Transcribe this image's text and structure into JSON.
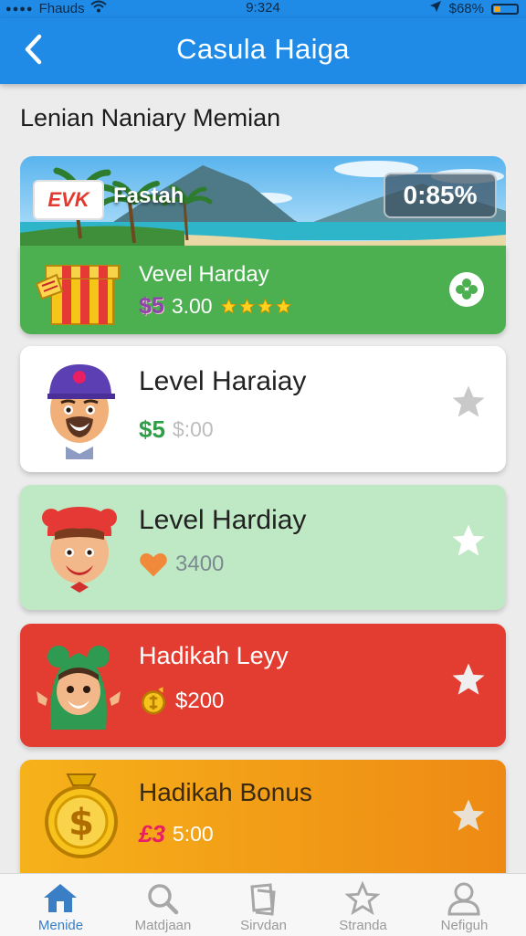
{
  "status_bar": {
    "carrier": "Fhauds",
    "time": "9:324",
    "battery": "$68%"
  },
  "nav": {
    "title": "Casula Haiga",
    "back_icon": "chevron-left-icon"
  },
  "subtitle": "Lenian  Naniary  Memian",
  "banner": {
    "brand": "EVK",
    "name": "Fastah",
    "progress": "0:85%"
  },
  "cards": [
    {
      "title": "Vevel Harday",
      "currency": "$5",
      "amount": "3.00",
      "rating": 4,
      "icon": "gift-box-icon",
      "action_icon": "clover-icon",
      "bg": "#4caf50"
    },
    {
      "title": "Level Haraiay",
      "currency": "$5",
      "amount": "$:00",
      "icon": "avatar-cap-icon",
      "action_icon": "star-icon",
      "bg": "#ffffff"
    },
    {
      "title": "Level Hardiay",
      "amount": "3400",
      "icon": "avatar-redhat-icon",
      "action_icon": "star-icon",
      "bg": "#bfe9c4"
    },
    {
      "title": "Hadikah Leyy",
      "amount": "$200",
      "icon": "avatar-hood-icon",
      "action_icon": "star-icon",
      "bg": "#e33c30"
    },
    {
      "title": "Hadikah Bonus",
      "currency": "£3",
      "amount": "5:00",
      "icon": "gold-coin-icon",
      "action_icon": "star-icon",
      "bg": "#f29a16"
    }
  ],
  "tabs": [
    {
      "label": "Menide",
      "icon": "home-icon",
      "active": true
    },
    {
      "label": "Matdjaan",
      "icon": "search-icon",
      "active": false
    },
    {
      "label": "Sirvdan",
      "icon": "cards-icon",
      "active": false
    },
    {
      "label": "Stranda",
      "icon": "star-icon",
      "active": false
    },
    {
      "label": "Nefiguh",
      "icon": "profile-icon",
      "active": false
    }
  ],
  "colors": {
    "primary": "#1f8be6",
    "tab_active": "#3a7fc6",
    "green_card": "#4caf50",
    "red_card": "#e33c30",
    "orange_card": "#f29a16"
  }
}
